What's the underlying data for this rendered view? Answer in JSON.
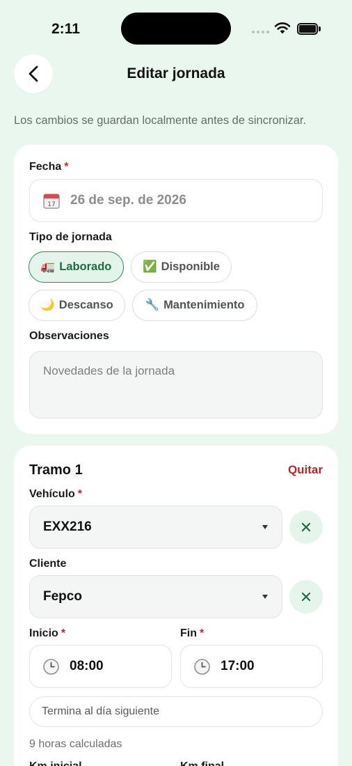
{
  "status": {
    "time": "2:11"
  },
  "header": {
    "title": "Editar jornada",
    "back_icon": "chevron-left-icon"
  },
  "subtitle": "Los cambios se guardan localmente antes de sincronizar.",
  "form": {
    "date": {
      "label": "Fecha",
      "required": "*",
      "value": "26 de sep. de 2026"
    },
    "type": {
      "label": "Tipo de jornada",
      "options": [
        {
          "emoji": "🚛",
          "label": "Laborado",
          "selected": true
        },
        {
          "emoji": "✅",
          "label": "Disponible",
          "selected": false
        },
        {
          "emoji": "🌙",
          "label": "Descanso",
          "selected": false
        },
        {
          "emoji": "🔧",
          "label": "Mantenimiento",
          "selected": false
        }
      ]
    },
    "notes": {
      "label": "Observaciones",
      "placeholder": "Novedades de la jornada"
    }
  },
  "segment": {
    "title": "Tramo 1",
    "remove_label": "Quitar",
    "vehicle": {
      "label": "Vehículo",
      "required": "*",
      "value": "EXX216"
    },
    "client": {
      "label": "Cliente",
      "value": "Fepco"
    },
    "start": {
      "label": "Inicio",
      "required": "*",
      "value": "08:00"
    },
    "end": {
      "label": "Fin",
      "required": "*",
      "value": "17:00"
    },
    "next_day_label": "Termina al día siguiente",
    "calculated": "9 horas calculadas",
    "km_start_label": "Km inicial",
    "km_end_label": "Km final"
  },
  "colors": {
    "background": "#eaf7ee",
    "accent": "#2f8f5b",
    "danger": "#b3262b"
  }
}
